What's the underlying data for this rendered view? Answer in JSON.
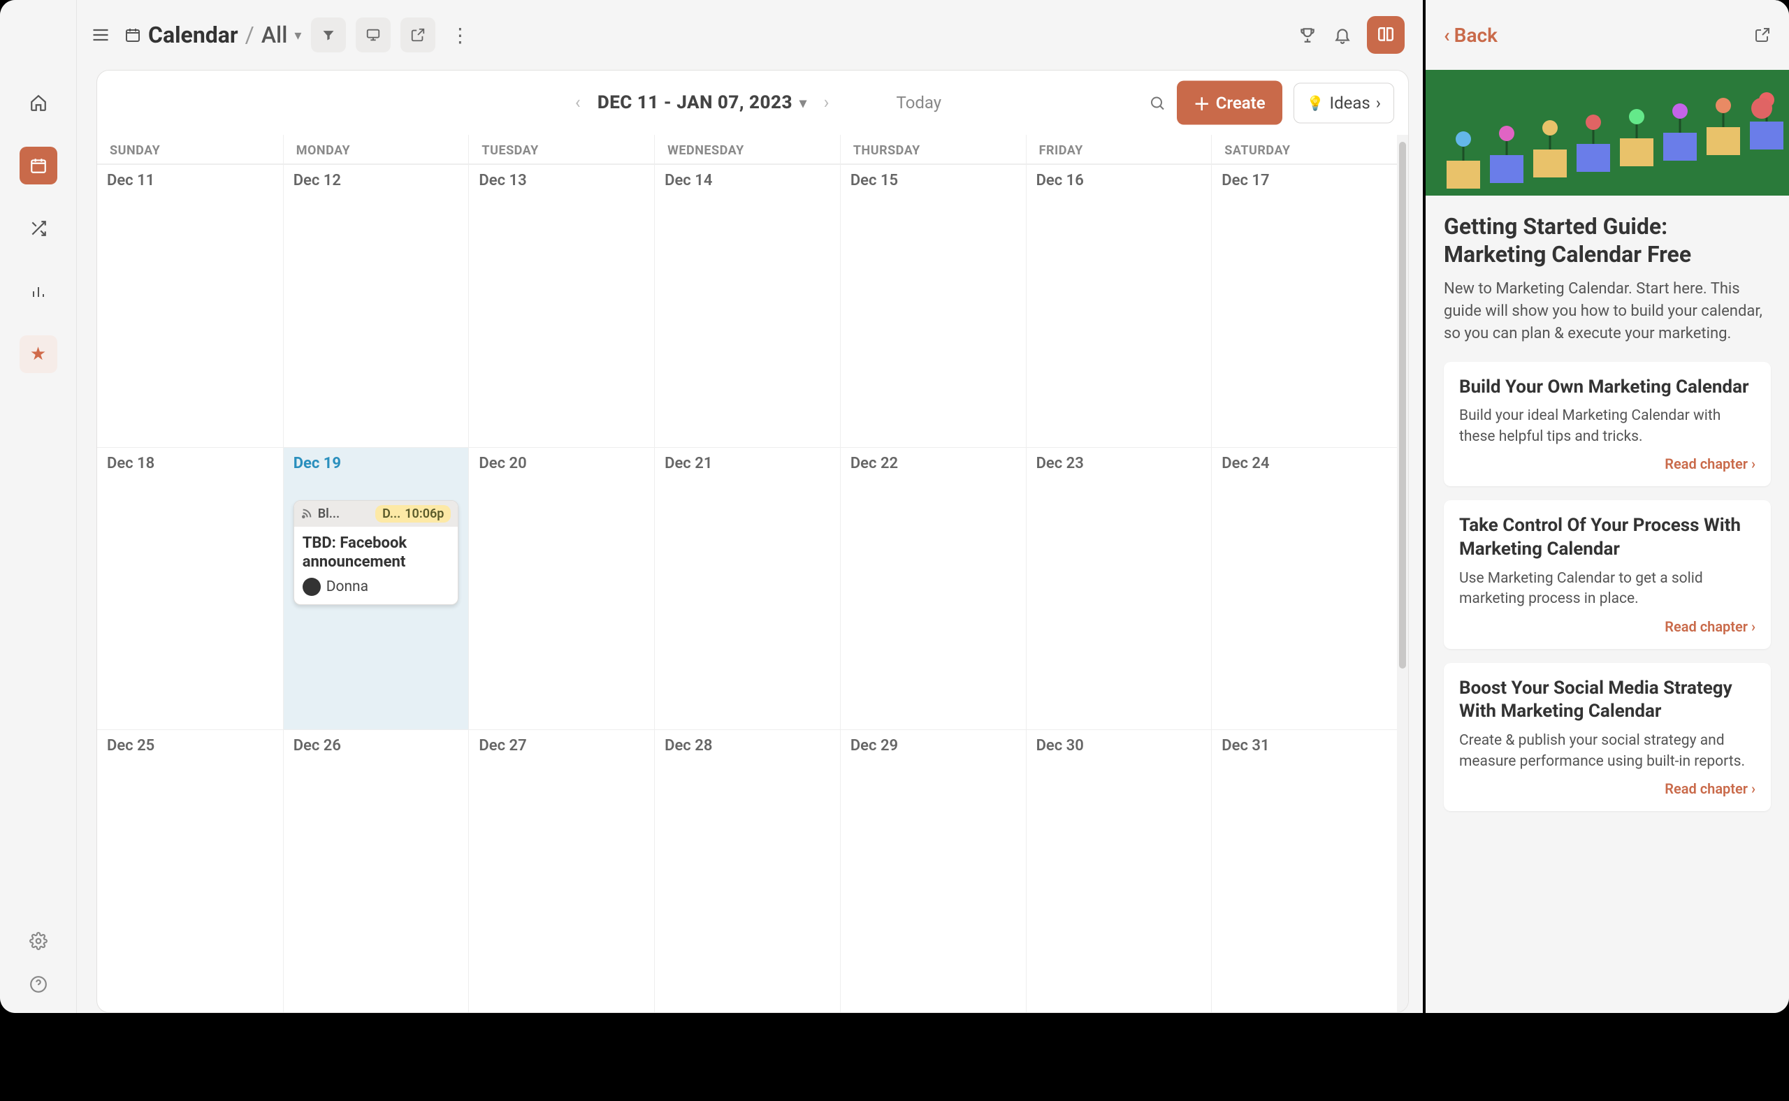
{
  "topbar": {
    "title": "Calendar",
    "sub": "All"
  },
  "cal": {
    "range_label": "DEC 11 - JAN 07, 2023",
    "today_label": "Today",
    "create_label": "Create",
    "ideas_label": "Ideas",
    "day_headers": [
      "SUNDAY",
      "MONDAY",
      "TUESDAY",
      "WEDNESDAY",
      "THURSDAY",
      "FRIDAY",
      "SATURDAY"
    ],
    "weeks": [
      [
        "Dec 11",
        "Dec 12",
        "Dec 13",
        "Dec 14",
        "Dec 15",
        "Dec 16",
        "Dec 17"
      ],
      [
        "Dec 18",
        "Dec 19",
        "Dec 20",
        "Dec 21",
        "Dec 22",
        "Dec 23",
        "Dec 24"
      ],
      [
        "Dec 25",
        "Dec 26",
        "Dec 27",
        "Dec 28",
        "Dec 29",
        "Dec 30",
        "Dec 31"
      ]
    ],
    "today_cell": "Dec 19",
    "event": {
      "type_short": "Bl...",
      "pill_prefix": "D...",
      "time": "10:06p",
      "title": "TBD: Facebook announcement",
      "owner": "Donna"
    }
  },
  "side": {
    "back_label": "Back",
    "title": "Getting Started Guide: Marketing Calendar Free",
    "desc": "New to Marketing Calendar. Start here. This guide will show you how to build your calendar, so you can plan & execute your marketing.",
    "read_label": "Read chapter",
    "chapters": [
      {
        "title": "Build Your Own Marketing Calendar",
        "desc": "Build your ideal Marketing Calendar with these helpful tips and tricks."
      },
      {
        "title": "Take Control Of Your Process With Marketing Calendar",
        "desc": "Use Marketing Calendar to get a solid marketing process in place."
      },
      {
        "title": "Boost Your Social Media Strategy With Marketing Calendar",
        "desc": "Create & publish your social strategy and measure performance using built-in reports."
      }
    ]
  }
}
